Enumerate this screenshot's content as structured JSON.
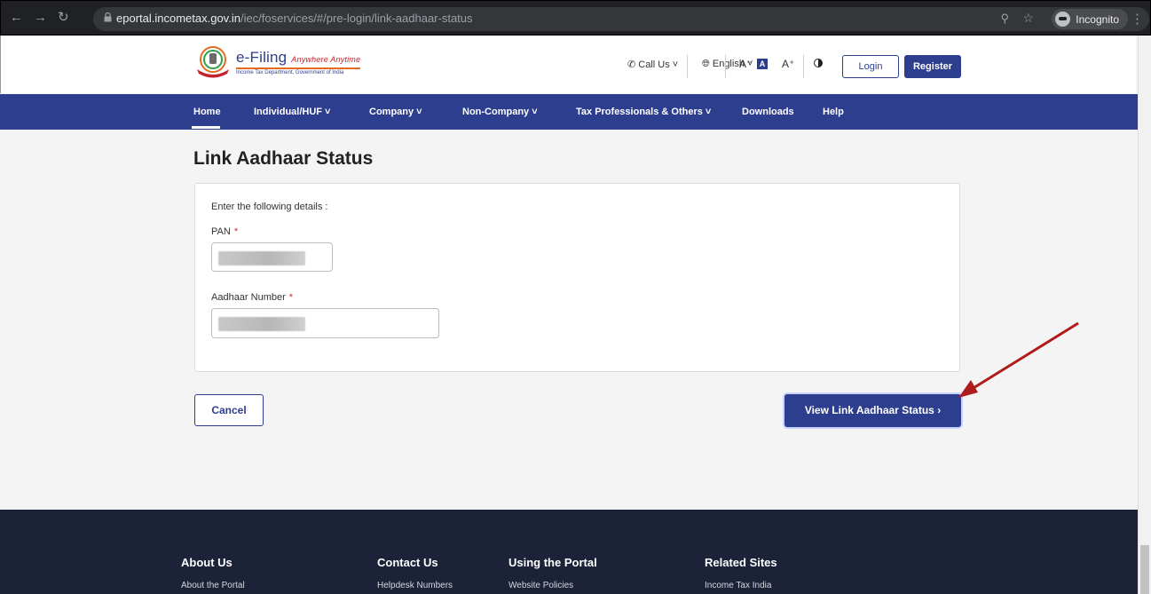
{
  "browser": {
    "url_host": "eportal.incometax.gov.in",
    "url_path": "/iec/foservices/#/pre-login/link-aadhaar-status",
    "profile_label": "Incognito"
  },
  "header": {
    "logo_name": "e-Filing",
    "logo_tagline": "Anywhere Anytime",
    "logo_sub": "Income Tax Department, Government of India",
    "call_us": "Call Us",
    "language": "English",
    "font_small": "A⁻",
    "font_normal": "A",
    "font_large": "A⁺",
    "login_label": "Login",
    "register_label": "Register"
  },
  "nav": {
    "items": [
      "Home",
      "Individual/HUF ˅",
      "Company ˅",
      "Non-Company ˅",
      "Tax Professionals & Others ˅",
      "Downloads",
      "Help"
    ]
  },
  "main": {
    "title": "Link Aadhaar Status",
    "intro": "Enter the following details :",
    "pan_label": "PAN",
    "aadhaar_label": "Aadhaar Number",
    "required_mark": "*",
    "cancel_label": "Cancel",
    "view_label": "View Link Aadhaar Status  ›"
  },
  "footer": {
    "columns": [
      {
        "heading": "About Us",
        "link": "About the Portal"
      },
      {
        "heading": "Contact Us",
        "link": "Helpdesk Numbers"
      },
      {
        "heading": "Using the Portal",
        "link": "Website Policies"
      },
      {
        "heading": "Related Sites",
        "link": "Income Tax India"
      }
    ]
  },
  "colors": {
    "brand_blue": "#2d3e8f",
    "footer_bg": "#1c2238",
    "annotation_arrow": "#b01c1c"
  }
}
